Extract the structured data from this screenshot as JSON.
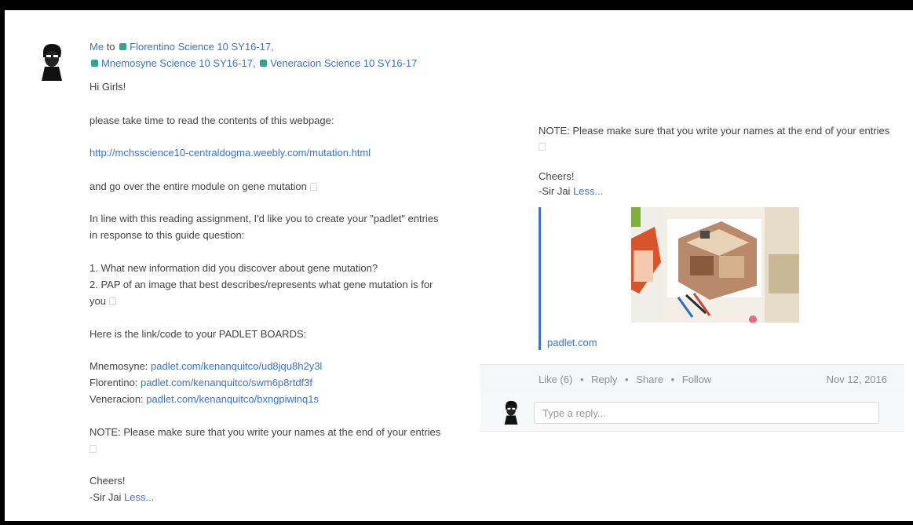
{
  "post": {
    "author": "Me",
    "to_word": "to",
    "recipients": [
      "Florentino Science 10 SY16-17,",
      "Mnemosyne Science 10 SY16-17,",
      "Veneracion Science 10 SY16-17"
    ],
    "greeting": "Hi Girls!",
    "para1": "please take time to read the contents of this webpage:",
    "link1": "http://mchsscience10-centraldogma.weebly.com/mutation.html",
    "para2": "and go over the entire module on gene mutation",
    "para3_line1": "In line with this reading assignment, I'd like you to create your \"padlet\" entries",
    "para3_line2": "in response to this guide question:",
    "q1": "1. What new information did you discover about gene mutation?",
    "q2_line1": "2. PAP of an image that best describes/represents what gene mutation is for",
    "q2_line2": "you",
    "boards_intro": "Here is the link/code to your PADLET BOARDS:",
    "boards": [
      {
        "name": "Mnemosyne:",
        "link": "padlet.com/kenanquitco/ud8jqu8h2y3l"
      },
      {
        "name": "Florentino:",
        "link": "padlet.com/kenanquitco/swm6p8rtdf3f"
      },
      {
        "name": "Veneracion:",
        "link": "padlet.com/kenanquitco/bxngpiwinq1s"
      }
    ],
    "note": "NOTE: Please make sure that you write your names at the end of your entries",
    "cheers": "Cheers!",
    "signature": "-Sir Jai",
    "less_link": "Less..."
  },
  "right": {
    "note": "NOTE: Please make sure that you write your names at the end of your entries",
    "cheers": "Cheers!",
    "signature": "-Sir Jai",
    "less_link": "Less...",
    "preview_link": "padlet.com"
  },
  "actions": {
    "like": "Like (6)",
    "reply": "Reply",
    "share": "Share",
    "follow": "Follow",
    "sep": "•",
    "date": "Nov 12, 2016"
  },
  "reply_box": {
    "placeholder": "Type a reply..."
  },
  "colors": {
    "link": "#3d74c7",
    "group_dot": "#2fa58a",
    "quote_bar": "#3d74c7"
  },
  "icons": [
    "avatar",
    "group-icon",
    "emoji-glyph",
    "preview-image"
  ]
}
